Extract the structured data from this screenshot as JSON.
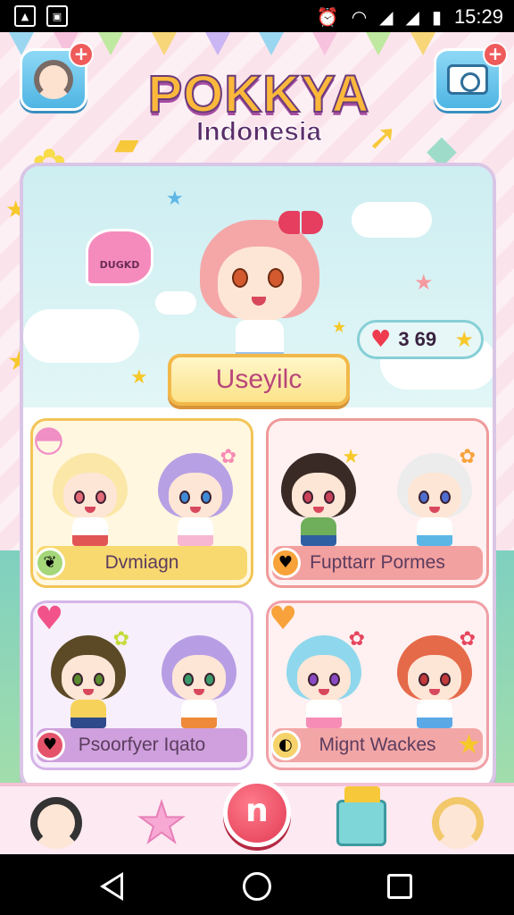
{
  "status_bar": {
    "time": "15:29",
    "left_icons": [
      "image-icon",
      "notification-app-icon"
    ],
    "right_icons": [
      "alarm-icon",
      "wifi-icon",
      "signal-icon",
      "signal-icon-2",
      "battery-icon"
    ]
  },
  "header": {
    "title": "POKKYA",
    "subtitle": "Indonesia",
    "profile_button_icon": "avatar-icon",
    "photo_button_icon": "camera-icon",
    "plus_symbol": "+"
  },
  "hero": {
    "speech_bubble_text": "DUGKD",
    "counter_value": "3 69",
    "name_banner": "Useyilc"
  },
  "cards": [
    {
      "label": "Dvmiagn",
      "icon": "leaf-icon",
      "label_color": "#f8d970",
      "border_color": "#f2c557"
    },
    {
      "label": "Fupttarr Pormes",
      "icon": "heart-icon",
      "label_color": "#f3a0a0",
      "border_color": "#ef9a9a"
    },
    {
      "label": "Psoorfyer Iqato",
      "icon": "heart-icon",
      "label_color": "#cfa0dd",
      "border_color": "#d5b4e8"
    },
    {
      "label": "Mignt Wackes",
      "icon": "shell-icon",
      "label_color": "#f3a6a6",
      "border_color": "#f0a0a6"
    }
  ],
  "bottom_nav": {
    "home_glyph": "n",
    "items": [
      "character-avatar-icon",
      "star-icon",
      "home-button",
      "gift-box-icon",
      "character-avatar-icon-2"
    ]
  },
  "colors": {
    "title_fill": "#fbb83b",
    "accent_red": "#e23b55",
    "panel_border": "#d9c6e6"
  }
}
